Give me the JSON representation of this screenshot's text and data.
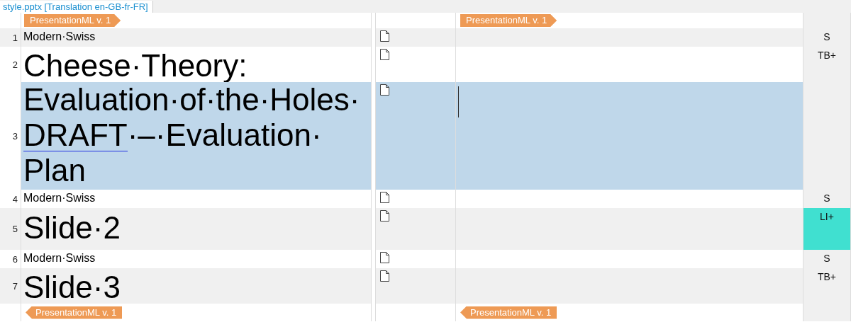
{
  "tab": {
    "title": "style.pptx [Translation en-GB-fr-FR]",
    "selected": true
  },
  "top_tags": {
    "source": {
      "label": "PresentationML v. 1",
      "kind": "start"
    },
    "target": {
      "label": "PresentationML v. 1",
      "kind": "start"
    }
  },
  "rows": [
    {
      "number": "1",
      "kind": "small",
      "source": [
        {
          "text": "Modern·Swiss",
          "flagged": false
        }
      ],
      "selected": false,
      "status": "S"
    },
    {
      "number": "2",
      "kind": "heading",
      "source": [
        {
          "text": "Cheese·Theory:",
          "flagged": false
        }
      ],
      "selected": false,
      "status": "TB+"
    },
    {
      "number": "3",
      "kind": "heading",
      "source": [
        {
          "text": "Evaluation·of·the·Holes·",
          "flagged": false
        },
        {
          "text": "DRAFT",
          "flagged": true
        },
        {
          "text": "·–·Evaluation·Plan",
          "flagged": false
        }
      ],
      "selected": true
    },
    {
      "number": "4",
      "kind": "small",
      "source": [
        {
          "text": "Modern·Swiss",
          "flagged": false
        }
      ],
      "selected": false,
      "status": "S"
    },
    {
      "number": "5",
      "kind": "heading",
      "source": [
        {
          "text": "Slide·2",
          "flagged": false
        }
      ],
      "selected": false,
      "status": "LI+",
      "color": "#40e0d0"
    },
    {
      "number": "6",
      "kind": "small",
      "source": [
        {
          "text": "Modern·Swiss",
          "flagged": false
        }
      ],
      "selected": false,
      "status": "S"
    },
    {
      "number": "7",
      "kind": "heading",
      "source": [
        {
          "text": "Slide·3",
          "flagged": false
        }
      ],
      "selected": false,
      "status": "TB+"
    }
  ],
  "bottom_tags": {
    "source": {
      "label": "PresentationML v. 1",
      "kind": "end"
    },
    "target": {
      "label": "PresentationML v. 1",
      "kind": "end"
    }
  }
}
